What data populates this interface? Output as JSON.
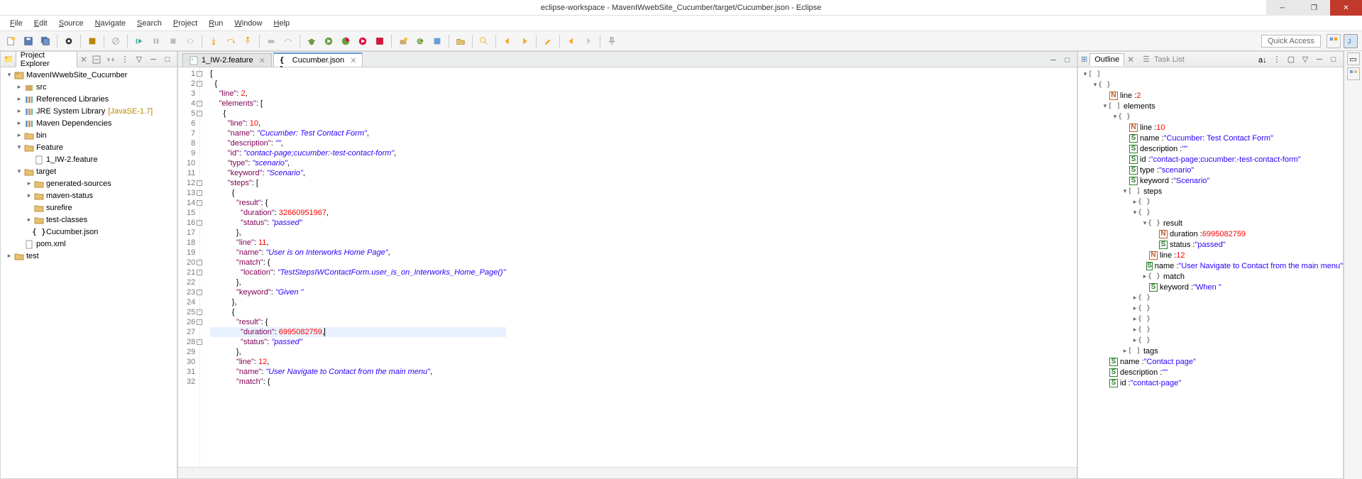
{
  "window": {
    "title": "eclipse-workspace - MavenIWwebSite_Cucumber/target/Cucumber.json - Eclipse"
  },
  "menu": [
    "File",
    "Edit",
    "Source",
    "Navigate",
    "Search",
    "Project",
    "Run",
    "Window",
    "Help"
  ],
  "quick_access": "Quick Access",
  "project_explorer": {
    "title": "Project Explorer",
    "tree": [
      {
        "d": 0,
        "tw": "▾",
        "ic": "proj",
        "label": "MavenIWwebSite_Cucumber"
      },
      {
        "d": 1,
        "tw": "▸",
        "ic": "pkgf",
        "label": "src"
      },
      {
        "d": 1,
        "tw": "▸",
        "ic": "lib",
        "label": "Referenced Libraries"
      },
      {
        "d": 1,
        "tw": "▸",
        "ic": "lib",
        "label": "JRE System Library",
        "deco": "[JavaSE-1.7]"
      },
      {
        "d": 1,
        "tw": "▸",
        "ic": "lib",
        "label": "Maven Dependencies"
      },
      {
        "d": 1,
        "tw": "▸",
        "ic": "fld",
        "label": "bin"
      },
      {
        "d": 1,
        "tw": "▾",
        "ic": "fld",
        "label": "Feature"
      },
      {
        "d": 2,
        "tw": "",
        "ic": "file",
        "label": "1_IW-2.feature"
      },
      {
        "d": 1,
        "tw": "▾",
        "ic": "fld",
        "label": "target"
      },
      {
        "d": 2,
        "tw": "▸",
        "ic": "fld",
        "label": "generated-sources"
      },
      {
        "d": 2,
        "tw": "▸",
        "ic": "fld",
        "label": "maven-status"
      },
      {
        "d": 2,
        "tw": "",
        "ic": "fld",
        "label": "surefire"
      },
      {
        "d": 2,
        "tw": "▸",
        "ic": "fld",
        "label": "test-classes"
      },
      {
        "d": 2,
        "tw": "",
        "ic": "json",
        "label": "Cucumber.json"
      },
      {
        "d": 1,
        "tw": "",
        "ic": "file",
        "label": "pom.xml"
      },
      {
        "d": 0,
        "tw": "▸",
        "ic": "fld",
        "label": "test"
      }
    ]
  },
  "editor": {
    "tabs": [
      {
        "icon": "feat",
        "label": "1_IW-2.feature",
        "active": false
      },
      {
        "icon": "json",
        "label": "Cucumber.json",
        "active": true
      }
    ],
    "lines": [
      {
        "n": 1,
        "fold": "-",
        "t": [
          [
            "p",
            "["
          ]
        ]
      },
      {
        "n": 2,
        "fold": "-",
        "t": [
          [
            "p",
            "  {"
          ]
        ]
      },
      {
        "n": 3,
        "t": [
          [
            "p",
            "    "
          ],
          [
            "k",
            "\"line\""
          ],
          [
            "p",
            ": "
          ],
          [
            "n",
            "2"
          ],
          [
            "p",
            ","
          ]
        ]
      },
      {
        "n": 4,
        "fold": "-",
        "t": [
          [
            "p",
            "    "
          ],
          [
            "k",
            "\"elements\""
          ],
          [
            "p",
            ": ["
          ]
        ]
      },
      {
        "n": 5,
        "fold": "-",
        "t": [
          [
            "p",
            "      {"
          ]
        ]
      },
      {
        "n": 6,
        "t": [
          [
            "p",
            "        "
          ],
          [
            "k",
            "\"line\""
          ],
          [
            "p",
            ": "
          ],
          [
            "n",
            "10"
          ],
          [
            "p",
            ","
          ]
        ]
      },
      {
        "n": 7,
        "t": [
          [
            "p",
            "        "
          ],
          [
            "k",
            "\"name\""
          ],
          [
            "p",
            ": "
          ],
          [
            "s",
            "\"Cucumber: Test Contact Form\""
          ],
          [
            "p",
            ","
          ]
        ]
      },
      {
        "n": 8,
        "t": [
          [
            "p",
            "        "
          ],
          [
            "k",
            "\"description\""
          ],
          [
            "p",
            ": "
          ],
          [
            "s",
            "\"\""
          ],
          [
            "p",
            ","
          ]
        ]
      },
      {
        "n": 9,
        "t": [
          [
            "p",
            "        "
          ],
          [
            "k",
            "\"id\""
          ],
          [
            "p",
            ": "
          ],
          [
            "s",
            "\"contact-page;cucumber:-test-contact-form\""
          ],
          [
            "p",
            ","
          ]
        ]
      },
      {
        "n": 10,
        "t": [
          [
            "p",
            "        "
          ],
          [
            "k",
            "\"type\""
          ],
          [
            "p",
            ": "
          ],
          [
            "s",
            "\"scenario\""
          ],
          [
            "p",
            ","
          ]
        ]
      },
      {
        "n": 11,
        "t": [
          [
            "p",
            "        "
          ],
          [
            "k",
            "\"keyword\""
          ],
          [
            "p",
            ": "
          ],
          [
            "s",
            "\"Scenario\""
          ],
          [
            "p",
            ","
          ]
        ]
      },
      {
        "n": 12,
        "fold": "-",
        "t": [
          [
            "p",
            "        "
          ],
          [
            "k",
            "\"steps\""
          ],
          [
            "p",
            ": ["
          ]
        ]
      },
      {
        "n": 13,
        "fold": "-",
        "t": [
          [
            "p",
            "          {"
          ]
        ]
      },
      {
        "n": 14,
        "fold": "-",
        "t": [
          [
            "p",
            "            "
          ],
          [
            "k",
            "\"result\""
          ],
          [
            "p",
            ": {"
          ]
        ]
      },
      {
        "n": 15,
        "t": [
          [
            "p",
            "              "
          ],
          [
            "k",
            "\"duration\""
          ],
          [
            "p",
            ": "
          ],
          [
            "n",
            "32660951967"
          ],
          [
            "p",
            ","
          ]
        ]
      },
      {
        "n": 16,
        "fold": "-",
        "t": [
          [
            "p",
            "              "
          ],
          [
            "k",
            "\"status\""
          ],
          [
            "p",
            ": "
          ],
          [
            "s",
            "\"passed\""
          ]
        ]
      },
      {
        "n": 17,
        "t": [
          [
            "p",
            "            },"
          ]
        ]
      },
      {
        "n": 18,
        "t": [
          [
            "p",
            "            "
          ],
          [
            "k",
            "\"line\""
          ],
          [
            "p",
            ": "
          ],
          [
            "n",
            "11"
          ],
          [
            "p",
            ","
          ]
        ]
      },
      {
        "n": 19,
        "t": [
          [
            "p",
            "            "
          ],
          [
            "k",
            "\"name\""
          ],
          [
            "p",
            ": "
          ],
          [
            "s",
            "\"User is on Interworks Home Page\""
          ],
          [
            "p",
            ","
          ]
        ]
      },
      {
        "n": 20,
        "fold": "-",
        "t": [
          [
            "p",
            "            "
          ],
          [
            "k",
            "\"match\""
          ],
          [
            "p",
            ": {"
          ]
        ]
      },
      {
        "n": 21,
        "fold": "-",
        "t": [
          [
            "p",
            "              "
          ],
          [
            "k",
            "\"location\""
          ],
          [
            "p",
            ": "
          ],
          [
            "s",
            "\"TestStepsIWContactForm.user_is_on_Interworks_Home_Page()\""
          ]
        ]
      },
      {
        "n": 22,
        "t": [
          [
            "p",
            "            },"
          ]
        ]
      },
      {
        "n": 23,
        "fold": "-",
        "t": [
          [
            "p",
            "            "
          ],
          [
            "k",
            "\"keyword\""
          ],
          [
            "p",
            ": "
          ],
          [
            "s",
            "\"Given \""
          ]
        ]
      },
      {
        "n": 24,
        "t": [
          [
            "p",
            "          },"
          ]
        ]
      },
      {
        "n": 25,
        "fold": "-",
        "t": [
          [
            "p",
            "          {"
          ]
        ]
      },
      {
        "n": 26,
        "fold": "-",
        "t": [
          [
            "p",
            "            "
          ],
          [
            "k",
            "\"result\""
          ],
          [
            "p",
            ": {"
          ]
        ]
      },
      {
        "n": 27,
        "cl": true,
        "t": [
          [
            "p",
            "              "
          ],
          [
            "k",
            "\"duration\""
          ],
          [
            "p",
            ": "
          ],
          [
            "n",
            "6995082759"
          ],
          [
            "p",
            ","
          ],
          [
            "cur",
            ""
          ]
        ]
      },
      {
        "n": 28,
        "fold": "-",
        "t": [
          [
            "p",
            "              "
          ],
          [
            "k",
            "\"status\""
          ],
          [
            "p",
            ": "
          ],
          [
            "s",
            "\"passed\""
          ]
        ]
      },
      {
        "n": 29,
        "t": [
          [
            "p",
            "            },"
          ]
        ]
      },
      {
        "n": 30,
        "t": [
          [
            "p",
            "            "
          ],
          [
            "k",
            "\"line\""
          ],
          [
            "p",
            ": "
          ],
          [
            "n",
            "12"
          ],
          [
            "p",
            ","
          ]
        ]
      },
      {
        "n": 31,
        "t": [
          [
            "p",
            "            "
          ],
          [
            "k",
            "\"name\""
          ],
          [
            "p",
            ": "
          ],
          [
            "s",
            "\"User Navigate to Contact from the main menu\""
          ],
          [
            "p",
            ","
          ]
        ]
      },
      {
        "n": 32,
        "t": [
          [
            "p",
            "            "
          ],
          [
            "k",
            "\"match\""
          ],
          [
            "p",
            ": {"
          ]
        ]
      }
    ]
  },
  "outline": {
    "title": "Outline",
    "tasklist": "Task List",
    "items": [
      {
        "d": 0,
        "tw": "▾",
        "ic": "br",
        "t": "[ ]"
      },
      {
        "d": 1,
        "tw": "▾",
        "ic": "br",
        "t": "{ }"
      },
      {
        "d": 2,
        "tw": "",
        "ic": "N",
        "key": "line : ",
        "vnum": "2"
      },
      {
        "d": 2,
        "tw": "▾",
        "ic": "br",
        "t": "[ ]",
        "key": "elements"
      },
      {
        "d": 3,
        "tw": "▾",
        "ic": "br",
        "t": "{ }"
      },
      {
        "d": 4,
        "tw": "",
        "ic": "N",
        "key": "line : ",
        "vnum": "10"
      },
      {
        "d": 4,
        "tw": "",
        "ic": "S",
        "key": "name : ",
        "vstr": "\"Cucumber: Test Contact Form\""
      },
      {
        "d": 4,
        "tw": "",
        "ic": "S",
        "key": "description : ",
        "vstr": "\"\""
      },
      {
        "d": 4,
        "tw": "",
        "ic": "S",
        "key": "id : ",
        "vstr": "\"contact-page;cucumber:-test-contact-form\""
      },
      {
        "d": 4,
        "tw": "",
        "ic": "S",
        "key": "type : ",
        "vstr": "\"scenario\""
      },
      {
        "d": 4,
        "tw": "",
        "ic": "S",
        "key": "keyword : ",
        "vstr": "\"Scenario\""
      },
      {
        "d": 4,
        "tw": "▾",
        "ic": "br",
        "t": "[ ]",
        "key": "steps"
      },
      {
        "d": 5,
        "tw": "▸",
        "ic": "br",
        "t": "{ }"
      },
      {
        "d": 5,
        "tw": "▾",
        "ic": "br",
        "t": "{ }"
      },
      {
        "d": 6,
        "tw": "▾",
        "ic": "br",
        "t": "{ }",
        "key": "result"
      },
      {
        "d": 7,
        "tw": "",
        "ic": "N",
        "key": "duration : ",
        "vnum": "6995082759"
      },
      {
        "d": 7,
        "tw": "",
        "ic": "S",
        "key": "status : ",
        "vstr": "\"passed\""
      },
      {
        "d": 6,
        "tw": "",
        "ic": "N",
        "key": "line : ",
        "vnum": "12"
      },
      {
        "d": 6,
        "tw": "",
        "ic": "S",
        "key": "name : ",
        "vstr": "\"User Navigate to Contact from the main menu\""
      },
      {
        "d": 6,
        "tw": "▸",
        "ic": "br",
        "t": "{ }",
        "key": "match"
      },
      {
        "d": 6,
        "tw": "",
        "ic": "S",
        "key": "keyword : ",
        "vstr": "\"When \""
      },
      {
        "d": 5,
        "tw": "▸",
        "ic": "br",
        "t": "{ }"
      },
      {
        "d": 5,
        "tw": "▸",
        "ic": "br",
        "t": "{ }"
      },
      {
        "d": 5,
        "tw": "▸",
        "ic": "br",
        "t": "{ }"
      },
      {
        "d": 5,
        "tw": "▸",
        "ic": "br",
        "t": "{ }"
      },
      {
        "d": 5,
        "tw": "▸",
        "ic": "br",
        "t": "{ }"
      },
      {
        "d": 4,
        "tw": "▸",
        "ic": "br",
        "t": "[ ]",
        "key": "tags"
      },
      {
        "d": 2,
        "tw": "",
        "ic": "S",
        "key": "name : ",
        "vstr": "\"Contact page\""
      },
      {
        "d": 2,
        "tw": "",
        "ic": "S",
        "key": "description : ",
        "vstr": "\"\""
      },
      {
        "d": 2,
        "tw": "",
        "ic": "S",
        "key": "id : ",
        "vstr": "\"contact-page\""
      }
    ]
  }
}
